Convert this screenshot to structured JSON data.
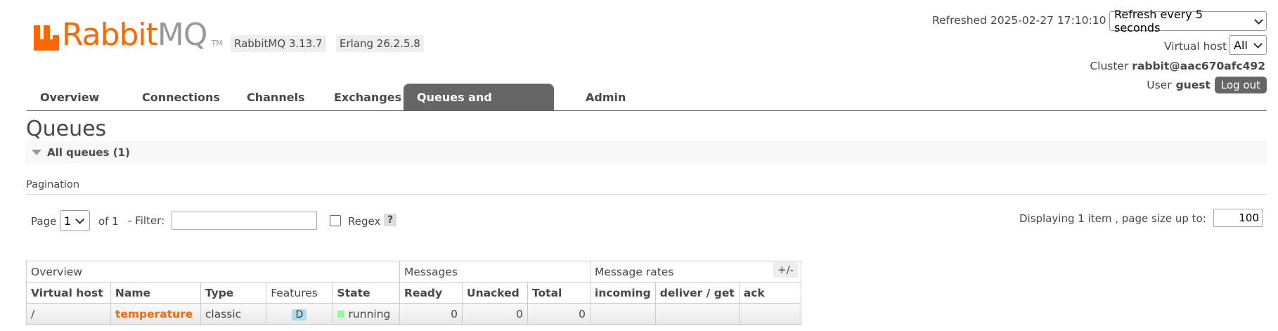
{
  "header": {
    "logo_text_orange": "Rabbit",
    "logo_text_grey": "MQ",
    "logo_tm": "TM",
    "version": "RabbitMQ 3.13.7",
    "erlang": "Erlang 26.2.5.8",
    "refreshed_label": "Refreshed 2025-02-27 17:10:10",
    "refresh_select": "Refresh every 5 seconds",
    "vhost_label": "Virtual host",
    "vhost_select": "All",
    "cluster_label": "Cluster",
    "cluster_name": "rabbit@aac670afc492",
    "user_label": "User",
    "user_name": "guest",
    "logout": "Log out"
  },
  "nav": {
    "tabs": [
      {
        "label": "Overview"
      },
      {
        "label": "Connections"
      },
      {
        "label": "Channels"
      },
      {
        "label": "Exchanges"
      },
      {
        "label": "Queues and Streams",
        "active": true
      },
      {
        "label": "Admin"
      }
    ]
  },
  "page": {
    "title": "Queues",
    "section": "All queues (1)",
    "pagination_label": "Pagination",
    "page_label": "Page",
    "page_value": "1",
    "of_label": "of 1",
    "filter_label": "- Filter:",
    "filter_value": "",
    "regex_label": "Regex",
    "help": "?",
    "displaying": "Displaying 1 item , page size up to:",
    "page_size": "100",
    "plus_minus": "+/-"
  },
  "table": {
    "groups": [
      "Overview",
      "Messages",
      "Message rates"
    ],
    "columns": [
      "Virtual host",
      "Name",
      "Type",
      "Features",
      "State",
      "Ready",
      "Unacked",
      "Total",
      "incoming",
      "deliver / get",
      "ack"
    ],
    "rows": [
      {
        "vhost": "/",
        "name": "temperature",
        "type": "classic",
        "feature": "D",
        "state": "running",
        "ready": "0",
        "unacked": "0",
        "total": "0",
        "incoming": "",
        "deliver": "",
        "ack": ""
      }
    ]
  },
  "colors": {
    "brand": "#ff6600",
    "tab_active": "#666666",
    "running": "#98f898",
    "durable_badge": "#aaddee"
  }
}
